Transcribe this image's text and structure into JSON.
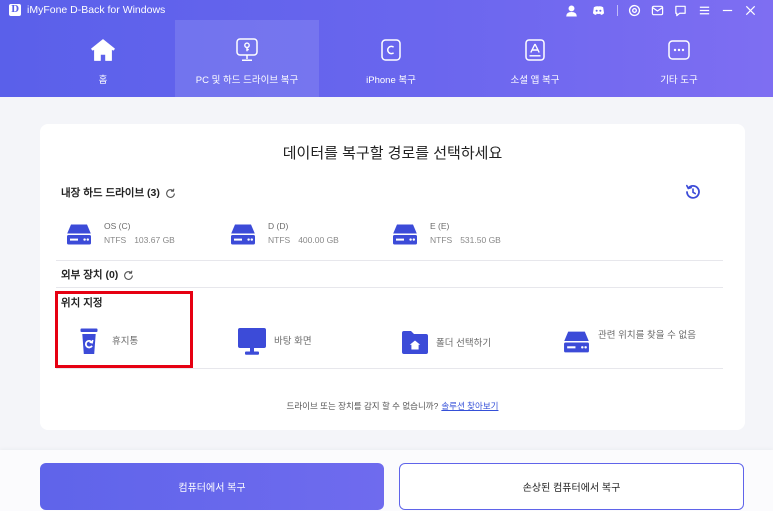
{
  "window": {
    "logo_letter": "D",
    "title": "iMyFone D-Back for Windows",
    "toolbar_icons": [
      "user-icon",
      "discord-icon",
      "settings-icon",
      "mail-icon",
      "chat-icon",
      "menu-icon",
      "minimize-icon",
      "close-icon"
    ]
  },
  "nav": {
    "tabs": [
      {
        "label": "홈",
        "icon": "home-icon",
        "active": false
      },
      {
        "label": "PC 및 하드 드라이브 복구",
        "icon": "pc-recovery-icon",
        "active": true
      },
      {
        "label": "iPhone 복구",
        "icon": "iphone-recovery-icon",
        "active": false
      },
      {
        "label": "소셜 앱 복구",
        "icon": "social-app-icon",
        "active": false
      },
      {
        "label": "기타 도구",
        "icon": "more-tools-icon",
        "active": false
      }
    ]
  },
  "main": {
    "heading": "데이터를 복구할 경로를 선택하세요",
    "history_icon": "history-icon",
    "internal_drives": {
      "label": "내장 하드 드라이브 (3)",
      "refresh_icon": "refresh-icon",
      "drives": [
        {
          "name": "OS (C)",
          "fs": "NTFS",
          "size": "103.67 GB",
          "icon": "hard-drive-icon"
        },
        {
          "name": "D (D)",
          "fs": "NTFS",
          "size": "400.00 GB",
          "icon": "hard-drive-icon"
        },
        {
          "name": "E (E)",
          "fs": "NTFS",
          "size": "531.50 GB",
          "icon": "hard-drive-icon"
        }
      ]
    },
    "external_devices": {
      "label": "외부 장치 (0)",
      "refresh_icon": "refresh-icon"
    },
    "locations": {
      "label": "위치 지정",
      "items": [
        {
          "label": "휴지통",
          "icon": "recycle-bin-icon"
        },
        {
          "label": "바탕 화면",
          "icon": "desktop-monitor-icon"
        },
        {
          "label": "폴더 선택하기",
          "icon": "folder-icon"
        },
        {
          "label": "관련 위치를 찾을 수 없음",
          "icon": "drive-unknown-icon"
        }
      ]
    },
    "footer": {
      "question": "드라이브 또는 장치를 감지 할 수 없습니까?",
      "link": "솔루션 찾아보기"
    }
  },
  "actions": {
    "primary_label": "컴퓨터에서 복구",
    "secondary_label": "손상된 컴퓨터에서 복구"
  },
  "colors": {
    "header_start": "#5a60ea",
    "header_end": "#7e6ef2",
    "accent": "#5f64ea",
    "icon_blue": "#3c4bd8",
    "link": "#3550d8",
    "highlight": "#e60012"
  }
}
